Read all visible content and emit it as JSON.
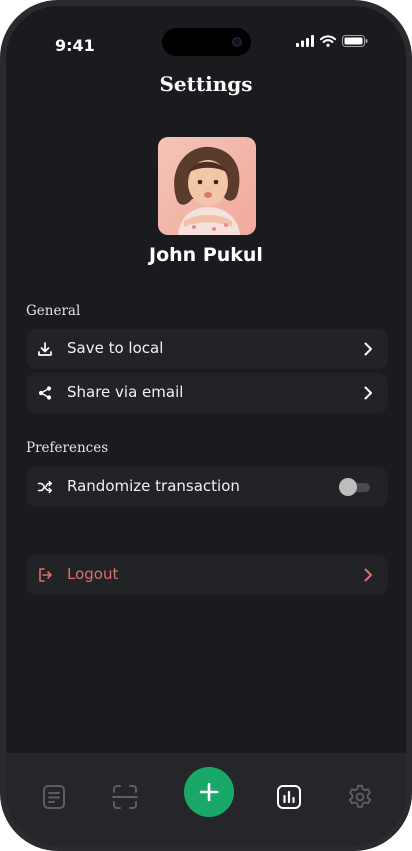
{
  "status_bar": {
    "time": "9:41"
  },
  "header": {
    "title": "Settings"
  },
  "profile": {
    "name": "John Pukul"
  },
  "sections": {
    "general": {
      "title": "General",
      "items": [
        {
          "label": "Save to local",
          "icon": "download-icon"
        },
        {
          "label": "Share via email",
          "icon": "share-icon"
        }
      ]
    },
    "preferences": {
      "title": "Preferences",
      "items": [
        {
          "label": "Randomize transaction",
          "icon": "shuffle-icon",
          "toggle_on": false
        }
      ]
    }
  },
  "logout": {
    "label": "Logout",
    "icon": "logout-icon"
  },
  "tab_bar": {
    "items": [
      "document-icon",
      "scan-icon",
      "add-icon",
      "chart-icon",
      "gear-icon"
    ],
    "active": "chart-icon"
  },
  "colors": {
    "accent": "#1aa86a",
    "danger": "#e16c6c",
    "background": "#1a1b1f",
    "card": "#222327"
  }
}
